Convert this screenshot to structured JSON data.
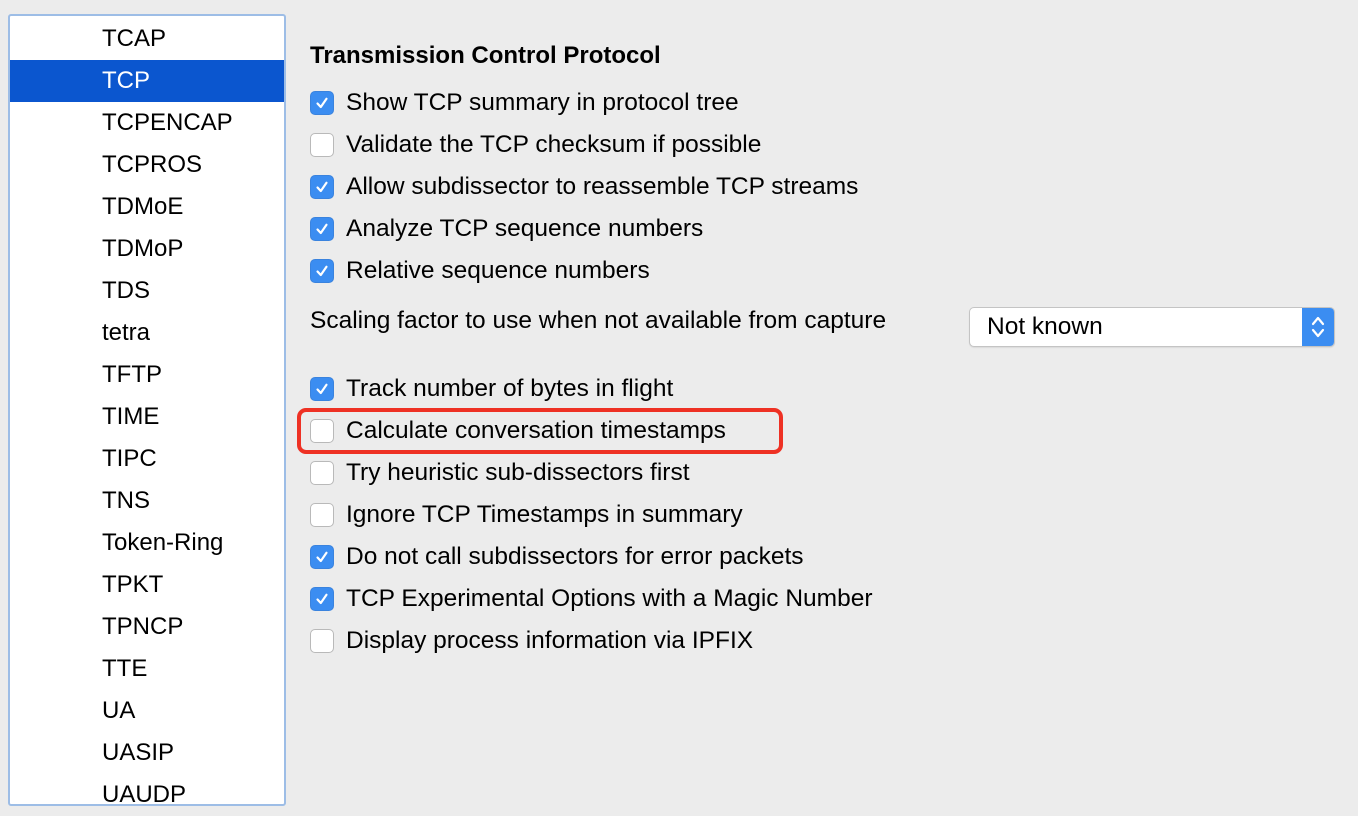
{
  "protocol_list": {
    "items": [
      {
        "label": "TCAP",
        "selected": false
      },
      {
        "label": "TCP",
        "selected": true
      },
      {
        "label": "TCPENCAP",
        "selected": false
      },
      {
        "label": "TCPROS",
        "selected": false
      },
      {
        "label": "TDMoE",
        "selected": false
      },
      {
        "label": "TDMoP",
        "selected": false
      },
      {
        "label": "TDS",
        "selected": false
      },
      {
        "label": "tetra",
        "selected": false
      },
      {
        "label": "TFTP",
        "selected": false
      },
      {
        "label": "TIME",
        "selected": false
      },
      {
        "label": "TIPC",
        "selected": false
      },
      {
        "label": "TNS",
        "selected": false
      },
      {
        "label": "Token-Ring",
        "selected": false
      },
      {
        "label": "TPKT",
        "selected": false
      },
      {
        "label": "TPNCP",
        "selected": false
      },
      {
        "label": "TTE",
        "selected": false
      },
      {
        "label": "UA",
        "selected": false
      },
      {
        "label": "UASIP",
        "selected": false
      },
      {
        "label": "UAUDP",
        "selected": false
      }
    ],
    "selection_color": "#0b56cf"
  },
  "preferences": {
    "title": "Transmission Control Protocol",
    "options_top": [
      {
        "label": "Show TCP summary in protocol tree",
        "checked": true
      },
      {
        "label": "Validate the TCP checksum if possible",
        "checked": false
      },
      {
        "label": "Allow subdissector to reassemble TCP streams",
        "checked": true
      },
      {
        "label": "Analyze TCP sequence numbers",
        "checked": true
      },
      {
        "label": "Relative sequence numbers",
        "checked": true
      }
    ],
    "scaling": {
      "label": "Scaling factor to use when not available from capture",
      "value": "Not known"
    },
    "options_bottom": [
      {
        "label": "Track number of bytes in flight",
        "checked": true
      },
      {
        "label": "Calculate conversation timestamps",
        "checked": false,
        "highlighted": true
      },
      {
        "label": "Try heuristic sub-dissectors first",
        "checked": false
      },
      {
        "label": "Ignore TCP Timestamps in summary",
        "checked": false
      },
      {
        "label": "Do not call subdissectors for error packets",
        "checked": true
      },
      {
        "label": "TCP Experimental Options with a Magic Number",
        "checked": true
      },
      {
        "label": "Display process information via IPFIX",
        "checked": false
      }
    ],
    "checkbox_color": "#3b8df1",
    "highlight_color": "#ee3124"
  }
}
